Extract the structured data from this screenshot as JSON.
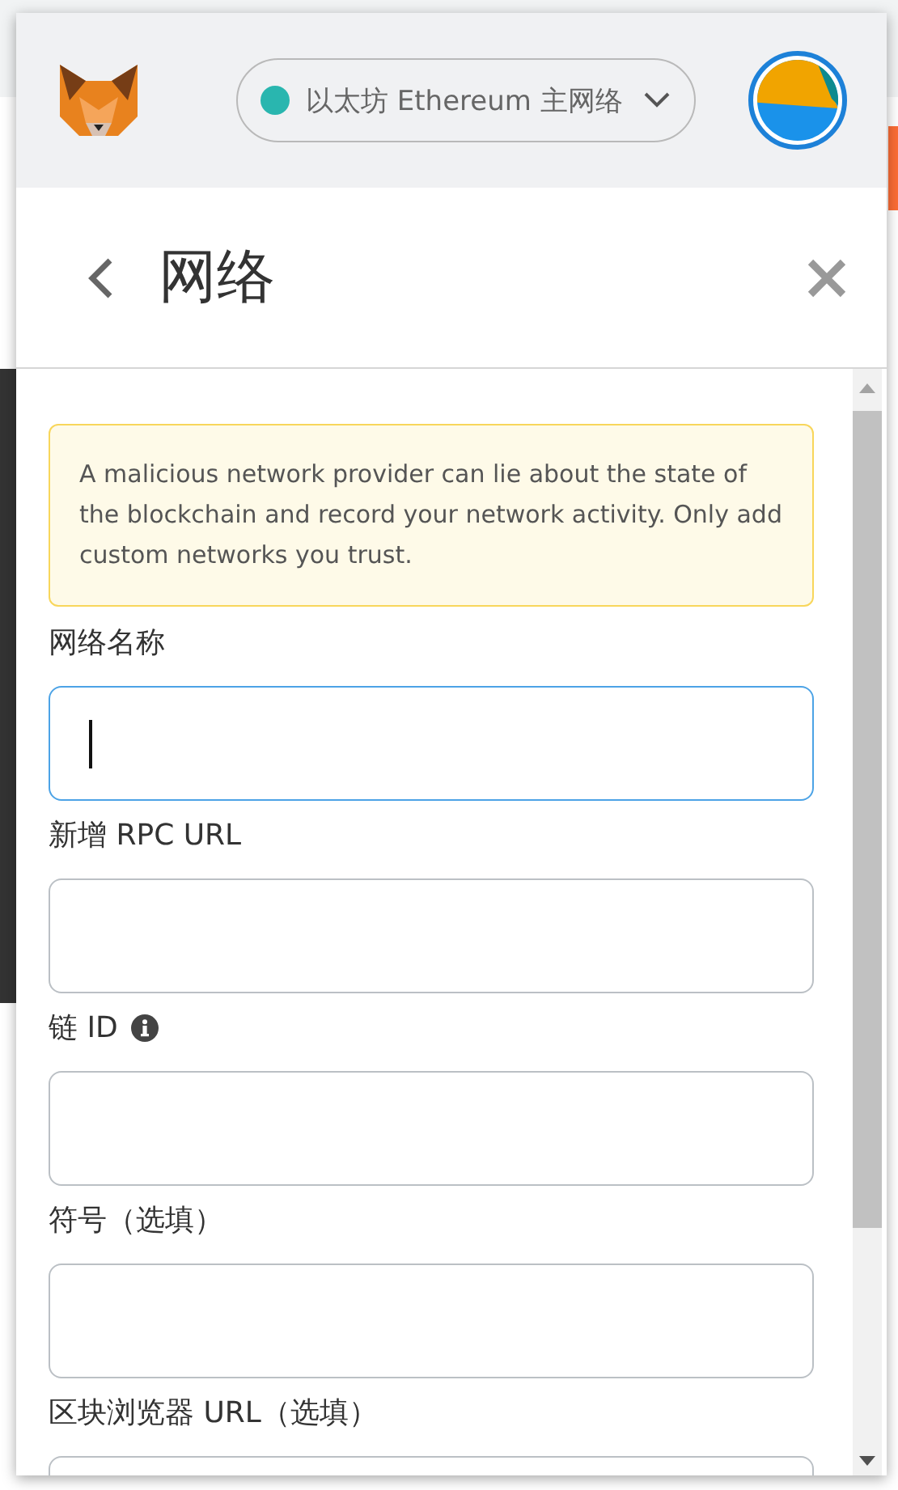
{
  "header": {
    "network": {
      "label": "以太坊 Ethereum 主网络",
      "color": "#29b6af"
    }
  },
  "page": {
    "title": "网络"
  },
  "notice": "A malicious network provider can lie about the state of the blockchain and record your network activity. Only add custom networks you trust.",
  "fields": [
    {
      "label": "网络名称",
      "focused": true,
      "info": false
    },
    {
      "label": "新增 RPC URL",
      "focused": false,
      "info": false
    },
    {
      "label": "链 ID",
      "focused": false,
      "info": true
    },
    {
      "label": "符号（选填）",
      "focused": false,
      "info": false
    },
    {
      "label": "区块浏览器 URL（选填）",
      "focused": false,
      "info": false
    }
  ]
}
